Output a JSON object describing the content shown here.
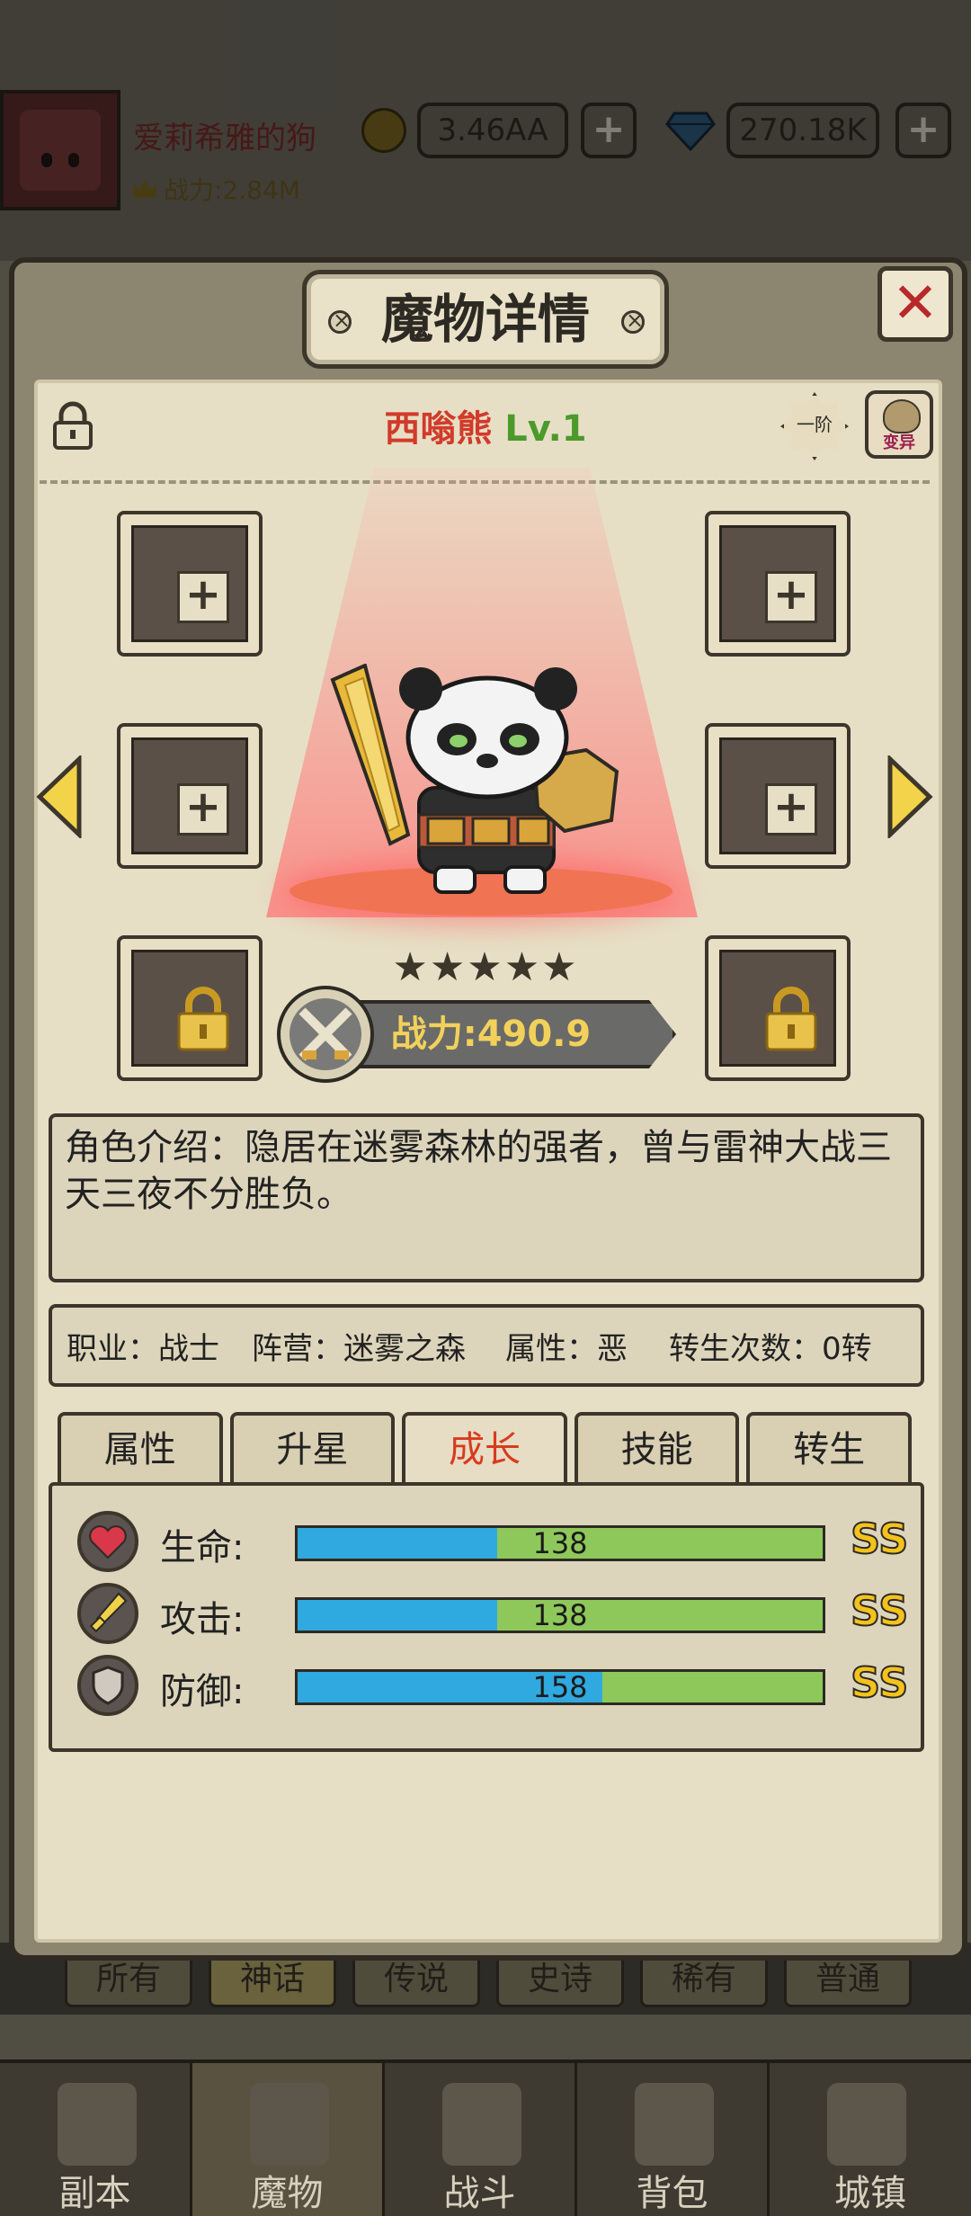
{
  "hud": {
    "player_name": "爱莉希雅的狗",
    "player_power": "战力:2.84M",
    "gold": "3.46AA",
    "gems": "270.18K",
    "plus": "+"
  },
  "background_tabs": [
    "所有",
    "神话",
    "传说",
    "史诗",
    "稀有",
    "普通"
  ],
  "modal": {
    "title": "魔物详情",
    "close": "✕",
    "monster_name": "西嗡熊",
    "monster_level": "Lv.1",
    "rank_badge": "一阶",
    "mutate_label": "变异",
    "stars": "★★★★★",
    "star_count": 5,
    "power": "战力:490.9",
    "description": "角色介绍：隐居在迷雾森林的强者，曾与雷神大战三天三夜不分胜负。",
    "info": {
      "class": "职业：战士",
      "camp": "阵营：迷雾之森",
      "attribute": "属性：恶",
      "rebirth": "转生次数：0转"
    },
    "tabs": [
      "属性",
      "升星",
      "成长",
      "技能",
      "转生"
    ],
    "active_tab": 2,
    "stats": [
      {
        "label": "生命:",
        "value": "138",
        "fill": 0.38,
        "grade": "SS",
        "icon": "heart-icon"
      },
      {
        "label": "攻击:",
        "value": "138",
        "fill": 0.38,
        "grade": "SS",
        "icon": "sword-icon"
      },
      {
        "label": "防御:",
        "value": "158",
        "fill": 0.58,
        "grade": "SS",
        "icon": "shield-icon"
      }
    ]
  },
  "nav": [
    "副本",
    "魔物",
    "战斗",
    "背包",
    "城镇"
  ],
  "nav_active": 1,
  "colors": {
    "name_red": "#d23a2a",
    "level_green": "#4b9a2a",
    "bar_blue": "#2fa9e0",
    "bar_green": "#8fc85a",
    "grade_gold": "#f4c21c",
    "power_gold": "#f2d15b"
  }
}
